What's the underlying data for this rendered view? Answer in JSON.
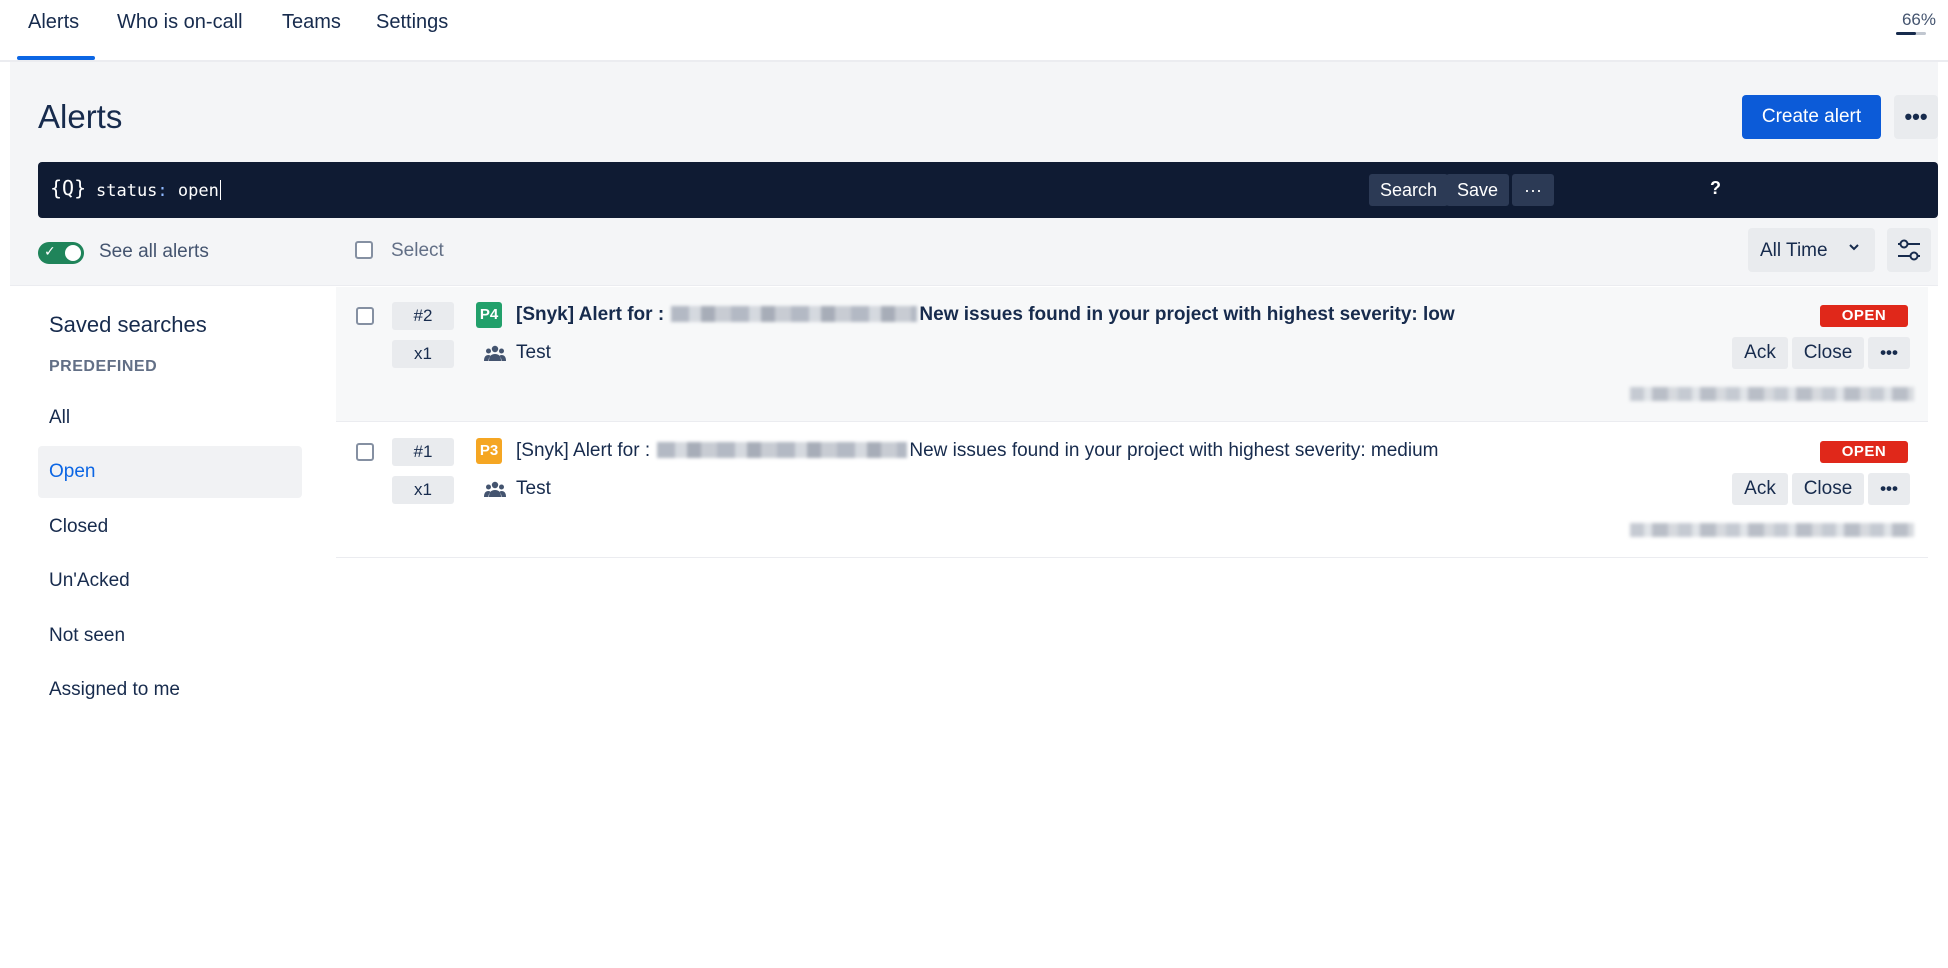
{
  "nav": {
    "tabs": [
      "Alerts",
      "Who is on-call",
      "Teams",
      "Settings"
    ],
    "active_tab": "Alerts",
    "zoom": "66%",
    "zoom_fraction": 0.66
  },
  "header": {
    "title": "Alerts",
    "create_label": "Create alert",
    "more_label": "•••"
  },
  "search": {
    "icon": "{Q}",
    "query_key": "status",
    "query_sep": ":",
    "query_value": "open",
    "help_label": "?",
    "search_label": "Search",
    "save_label": "Save",
    "more_label": "···"
  },
  "toolbar": {
    "see_all_label": "See all alerts",
    "see_all_on": true,
    "select_label": "Select",
    "time_filter": "All Time"
  },
  "sidebar": {
    "title": "Saved searches",
    "section": "PREDEFINED",
    "items": [
      "All",
      "Open",
      "Closed",
      "Un'Acked",
      "Not seen",
      "Assigned to me"
    ],
    "selected": "Open"
  },
  "alerts": [
    {
      "number": "#2",
      "count": "x1",
      "priority": "P4",
      "priority_color": "#22a06b",
      "title_prefix": "[Snyk] Alert for :",
      "title_suffix": "New issues found in your project with highest severity: low",
      "team": "Test",
      "status": "OPEN",
      "ack_label": "Ack",
      "close_label": "Close",
      "more_label": "•••"
    },
    {
      "number": "#1",
      "count": "x1",
      "priority": "P3",
      "priority_color": "#f5a623",
      "title_prefix": "[Snyk] Alert for :",
      "title_suffix": "New issues found in your project with highest severity: medium",
      "team": "Test",
      "status": "OPEN",
      "ack_label": "Ack",
      "close_label": "Close",
      "more_label": "•••"
    }
  ],
  "colors": {
    "accent": "#0c5bd8",
    "searchbar_bg": "#0f1b33",
    "toggle_on": "#1f845a",
    "status_open": "#e0281a"
  },
  "icons": {
    "team": "people-group-icon",
    "filter": "sliders-icon",
    "chevron": "chevron-down-icon"
  }
}
